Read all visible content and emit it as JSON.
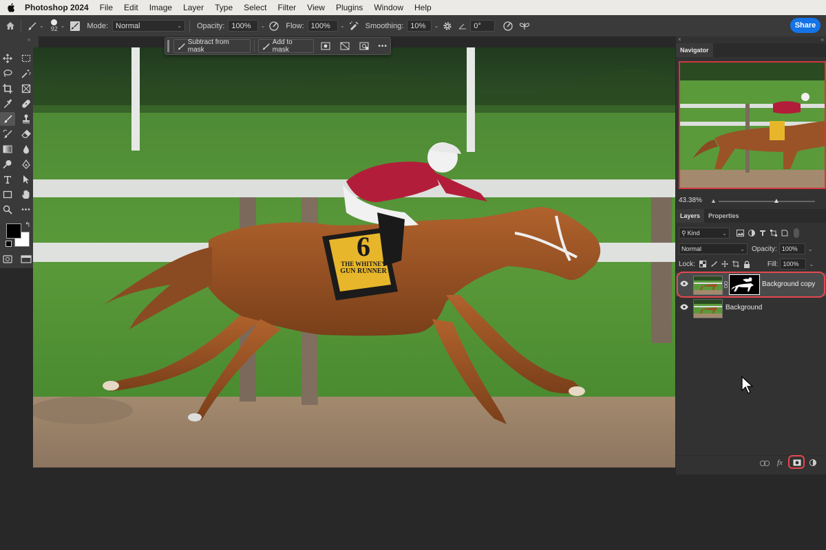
{
  "menubar": {
    "app_name": "Photoshop 2024",
    "items": [
      "File",
      "Edit",
      "Image",
      "Layer",
      "Type",
      "Select",
      "Filter",
      "View",
      "Plugins",
      "Window",
      "Help"
    ]
  },
  "options": {
    "brush_size": "92",
    "mode_label": "Mode:",
    "mode_value": "Normal",
    "opacity_label": "Opacity:",
    "opacity_value": "100%",
    "flow_label": "Flow:",
    "flow_value": "100%",
    "smoothing_label": "Smoothing:",
    "smoothing_value": "10%",
    "angle_value": "0°",
    "share_label": "Share"
  },
  "contextual_bar": {
    "subtract_label": "Subtract from mask",
    "add_label": "Add to mask",
    "more_label": "•••"
  },
  "navigator": {
    "tab_label": "Navigator",
    "zoom_value": "43.38%",
    "zoom_slider_fraction": 0.6
  },
  "layers_panel": {
    "tabs": [
      "Layers",
      "Properties"
    ],
    "filter_label": "Kind",
    "blend_mode": "Normal",
    "opacity_label": "Opacity:",
    "opacity_value": "100%",
    "lock_label": "Lock:",
    "fill_label": "Fill:",
    "fill_value": "100%",
    "layers": [
      {
        "name": "Background copy",
        "selected": true,
        "has_mask": true
      },
      {
        "name": "Background",
        "selected": false,
        "has_mask": false
      }
    ]
  },
  "photo_bib": {
    "number": "6",
    "line1": "THE WHITNEY",
    "line2": "GUN RUNNER"
  },
  "colors": {
    "highlight_ring": "#e5484d",
    "share_blue": "#1473e6",
    "foreground": "#000000",
    "background": "#ffffff"
  },
  "icons": [
    "apple-icon",
    "home-icon",
    "brush-icon",
    "brush-settings-icon",
    "airbrush-icon",
    "pressure-flow-icon",
    "gear-icon",
    "angle-icon",
    "pressure-size-icon",
    "symmetry-icon",
    "eye-icon",
    "link-icon",
    "add-mask-icon",
    "fx-icon",
    "adjustment-icon",
    "cursor-icon"
  ]
}
